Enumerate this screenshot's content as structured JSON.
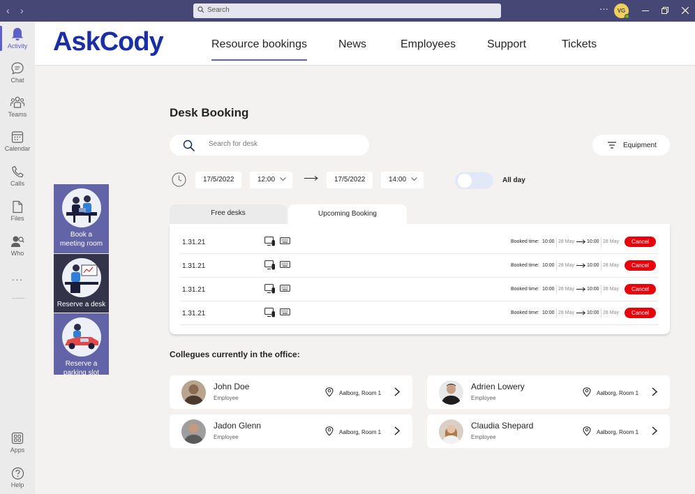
{
  "titlebar": {
    "search_placeholder": "Search",
    "user_initials": "VG",
    "more": "···"
  },
  "rail": {
    "items": [
      {
        "label": "Activity",
        "icon": "bell-icon",
        "active": true
      },
      {
        "label": "Chat",
        "icon": "chat-icon"
      },
      {
        "label": "Teams",
        "icon": "teams-icon"
      },
      {
        "label": "Calendar",
        "icon": "calendar-icon"
      },
      {
        "label": "Calls",
        "icon": "phone-icon"
      },
      {
        "label": "Files",
        "icon": "file-icon"
      },
      {
        "label": "Who",
        "icon": "who-icon"
      }
    ],
    "more": "···",
    "bottom": [
      {
        "label": "Apps",
        "icon": "apps-icon"
      },
      {
        "label": "Help",
        "icon": "help-icon"
      }
    ]
  },
  "app": {
    "logo": "AskCody",
    "nav": [
      "Resource bookings",
      "News",
      "Employees",
      "Support",
      "Tickets"
    ],
    "active_nav": "Resource bookings",
    "actions": [
      {
        "line1": "Book a",
        "line2": "meeting room"
      },
      {
        "line1": "Reserve a desk",
        "line2": ""
      },
      {
        "line1": "Reserve a",
        "line2": "parking slot"
      }
    ]
  },
  "desk": {
    "title": "Desk Booking",
    "search_placeholder": "Search for desk",
    "equipment_label": "Equipment",
    "start_date": "17/5/2022",
    "start_time": "12:00",
    "end_date": "17/5/2022",
    "end_time": "14:00",
    "all_day_label": "All day",
    "tabs": [
      "Free desks",
      "Upcoming Booking"
    ],
    "bookings": [
      {
        "desk": "1.31.21",
        "booked_label": "Booked time:",
        "start": "10:00",
        "start_date": "28 May",
        "end": "10:00",
        "end_date": "28 May",
        "cancel": "Cancel"
      },
      {
        "desk": "1.31.21",
        "booked_label": "Booked time:",
        "start": "10:00",
        "start_date": "28 May",
        "end": "10:00",
        "end_date": "28 May",
        "cancel": "Cancel"
      },
      {
        "desk": "1.31.21",
        "booked_label": "Booked time:",
        "start": "10:00",
        "start_date": "28 May",
        "end": "10:00",
        "end_date": "28 May",
        "cancel": "Cancel"
      },
      {
        "desk": "1.31.21",
        "booked_label": "Booked time:",
        "start": "10:00",
        "start_date": "28 May",
        "end": "10:00",
        "end_date": "28 May",
        "cancel": "Cancel"
      }
    ]
  },
  "colleagues": {
    "title": "Collegues currently in the office:",
    "people": [
      {
        "name": "John Doe",
        "role": "Employee",
        "location": "Aalborg, Room 1"
      },
      {
        "name": "Adrien Lowery",
        "role": "Employee",
        "location": "Aalborg, Room 1"
      },
      {
        "name": "Jadon Glenn",
        "role": "Employee",
        "location": "Aalborg, Room 1"
      },
      {
        "name": "Claudia Shepard",
        "role": "Employee",
        "location": "Aalborg, Room 1"
      }
    ]
  },
  "colors": {
    "titlebar": "#464775",
    "accent": "#5b5fc7",
    "action_panel": "#6264a7",
    "logo": "#1a2ea6",
    "cancel": "#e8000b"
  }
}
